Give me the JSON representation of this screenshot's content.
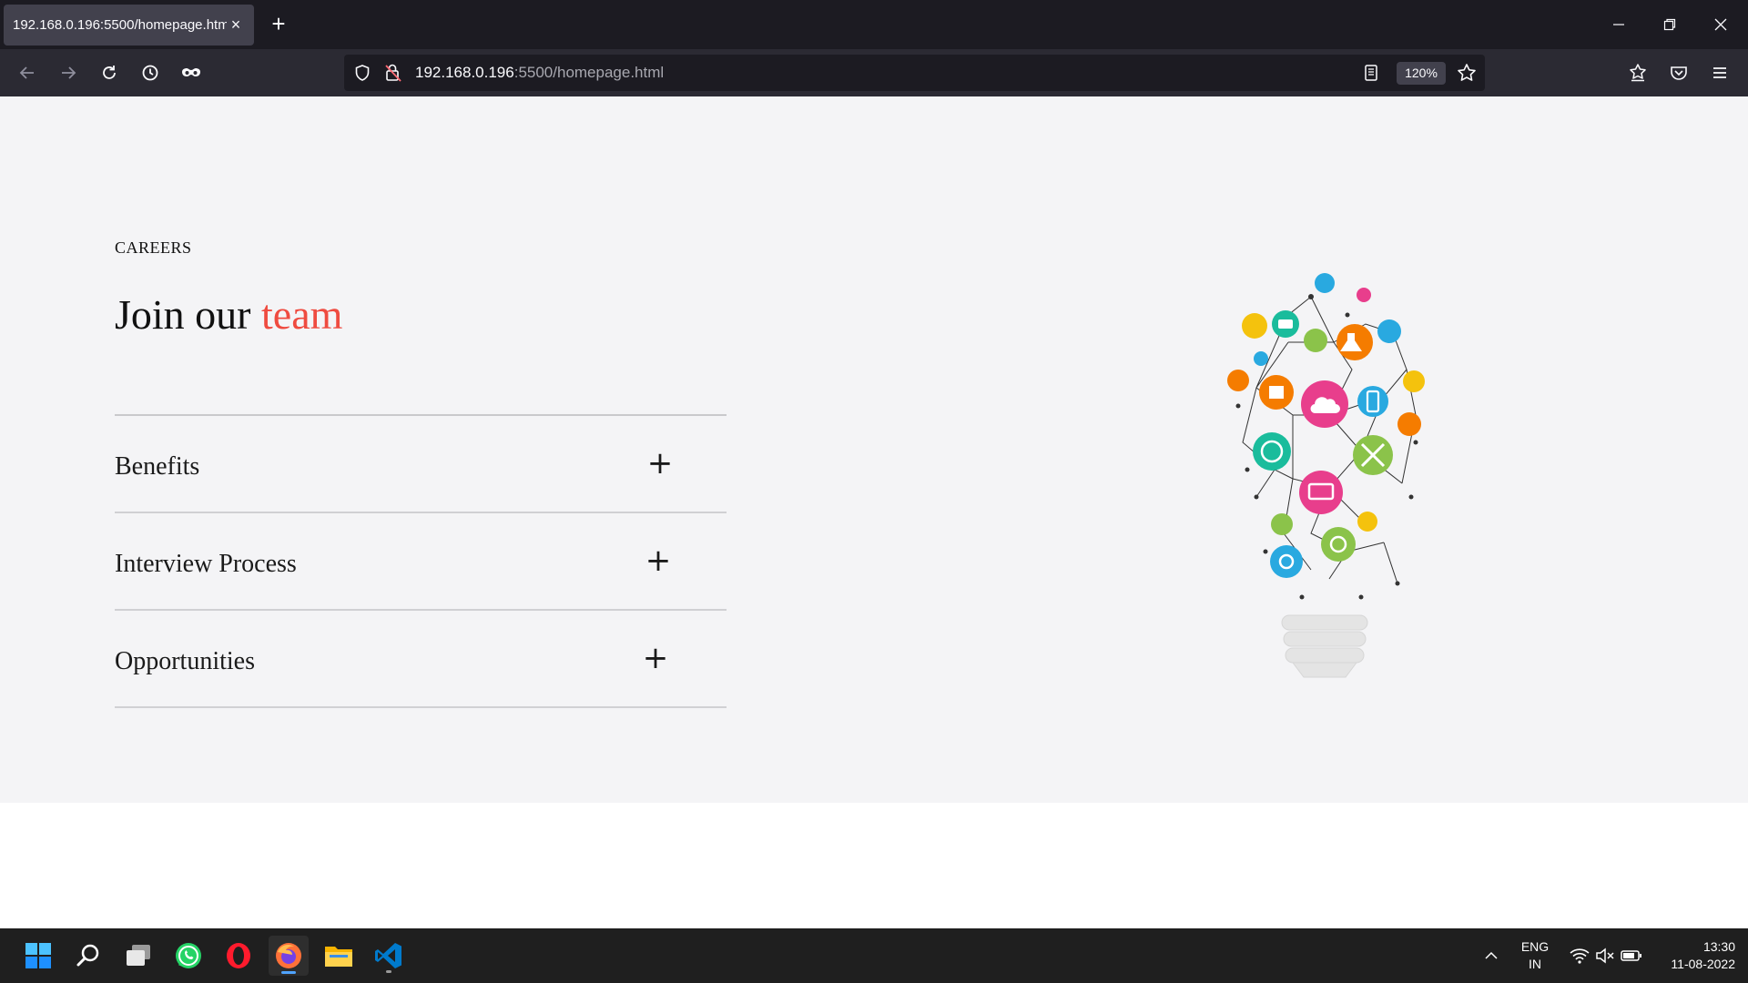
{
  "browser": {
    "tab_title": "192.168.0.196:5500/homepage.html",
    "tab_close": "×",
    "new_tab": "+",
    "url_host": "192.168.0.196",
    "url_rest": ":5500/homepage.html",
    "zoom": "120%"
  },
  "page": {
    "eyebrow": "CAREERS",
    "heading_main": "Join our",
    "heading_accent": "team",
    "accent_color": "#ef4b40",
    "accordion": [
      {
        "label": "Benefits",
        "icon": "+"
      },
      {
        "label": "Interview Process",
        "icon": "+"
      },
      {
        "label": "Opportunities",
        "icon": "+"
      }
    ]
  },
  "taskbar": {
    "apps": [
      "start",
      "search",
      "task-view",
      "whatsapp",
      "opera",
      "firefox",
      "file-explorer",
      "vscode"
    ],
    "lang_line1": "ENG",
    "lang_line2": "IN",
    "time": "13:30",
    "date": "11-08-2022"
  }
}
